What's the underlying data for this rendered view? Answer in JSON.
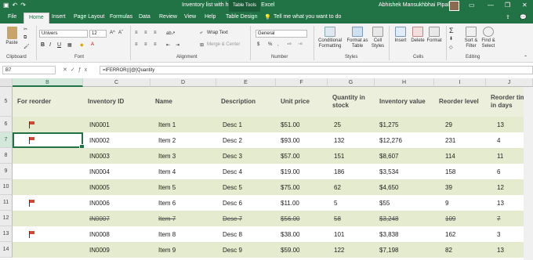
{
  "window": {
    "title": "Inventory list with highlighting1 - Excel",
    "contextual_tab": "Table Tools",
    "user": "Abhishek Mansukhbhai Pipaliya"
  },
  "tabs": [
    {
      "label": "File"
    },
    {
      "label": "Home"
    },
    {
      "label": "Insert"
    },
    {
      "label": "Page Layout"
    },
    {
      "label": "Formulas"
    },
    {
      "label": "Data"
    },
    {
      "label": "Review"
    },
    {
      "label": "View"
    },
    {
      "label": "Help"
    },
    {
      "label": "Table Design"
    }
  ],
  "tell_me": "Tell me what you want to do",
  "ribbon": {
    "paste": "Paste",
    "clipboard": "Clipboard",
    "font_name": "Univers",
    "font_size": "12",
    "font_group": "Font",
    "wrap_text": "Wrap Text",
    "merge_center": "Merge & Center",
    "alignment": "Alignment",
    "number_format": "General",
    "number_group": "Number",
    "conditional_formatting": "Conditional Formatting",
    "format_as_table": "Format as Table",
    "cell_styles": "Cell Styles",
    "styles": "Styles",
    "insert": "Insert",
    "delete": "Delete",
    "format": "Format",
    "cells": "Cells",
    "sort_filter": "Sort & Filter",
    "find_select": "Find & Select",
    "editing": "Editing",
    "bold": "B",
    "italic": "I",
    "underline": "U",
    "currency": "$",
    "percent": "%"
  },
  "formula_bar": {
    "name_box": "B7",
    "formula": "=IFERROR(([@[Quantity"
  },
  "columns": [
    "B",
    "C",
    "D",
    "E",
    "F",
    "G",
    "H",
    "I",
    "J"
  ],
  "headers": [
    "For reorder",
    "Inventory ID",
    "Name",
    "Description",
    "Unit price",
    "Quantity in stock",
    "Inventory value",
    "Reorder level",
    "Reorder time in days"
  ],
  "rows": [
    {
      "num": "6",
      "flag": true,
      "id": "IN0001",
      "name": "Item 1",
      "desc": "Desc 1",
      "price": "$51.00",
      "qty": "25",
      "value": "$1,275",
      "level": "29",
      "days": "13",
      "strike": false
    },
    {
      "num": "7",
      "flag": true,
      "id": "IN0002",
      "name": "Item 2",
      "desc": "Desc 2",
      "price": "$93.00",
      "qty": "132",
      "value": "$12,276",
      "level": "231",
      "days": "4",
      "strike": false
    },
    {
      "num": "8",
      "flag": false,
      "id": "IN0003",
      "name": "Item 3",
      "desc": "Desc 3",
      "price": "$57.00",
      "qty": "151",
      "value": "$8,607",
      "level": "114",
      "days": "11",
      "strike": false
    },
    {
      "num": "9",
      "flag": false,
      "id": "IN0004",
      "name": "Item 4",
      "desc": "Desc 4",
      "price": "$19.00",
      "qty": "186",
      "value": "$3,534",
      "level": "158",
      "days": "6",
      "strike": false
    },
    {
      "num": "10",
      "flag": false,
      "id": "IN0005",
      "name": "Item 5",
      "desc": "Desc 5",
      "price": "$75.00",
      "qty": "62",
      "value": "$4,650",
      "level": "39",
      "days": "12",
      "strike": false
    },
    {
      "num": "11",
      "flag": true,
      "id": "IN0006",
      "name": "Item 6",
      "desc": "Desc 6",
      "price": "$11.00",
      "qty": "5",
      "value": "$55",
      "level": "9",
      "days": "13",
      "strike": false
    },
    {
      "num": "12",
      "flag": false,
      "id": "IN0007",
      "name": "Item 7",
      "desc": "Desc 7",
      "price": "$56.00",
      "qty": "58",
      "value": "$3,248",
      "level": "109",
      "days": "7",
      "strike": true
    },
    {
      "num": "13",
      "flag": true,
      "id": "IN0008",
      "name": "Item 8",
      "desc": "Desc 8",
      "price": "$38.00",
      "qty": "101",
      "value": "$3,838",
      "level": "162",
      "days": "3",
      "strike": false
    },
    {
      "num": "14",
      "flag": false,
      "id": "IN0009",
      "name": "Item 9",
      "desc": "Desc 9",
      "price": "$59.00",
      "qty": "122",
      "value": "$7,198",
      "level": "82",
      "days": "13",
      "strike": false
    }
  ],
  "header_row_num": "5",
  "colors": {
    "excel_green": "#217346",
    "band": "#e4ebce",
    "header_band": "#ecefdc"
  }
}
